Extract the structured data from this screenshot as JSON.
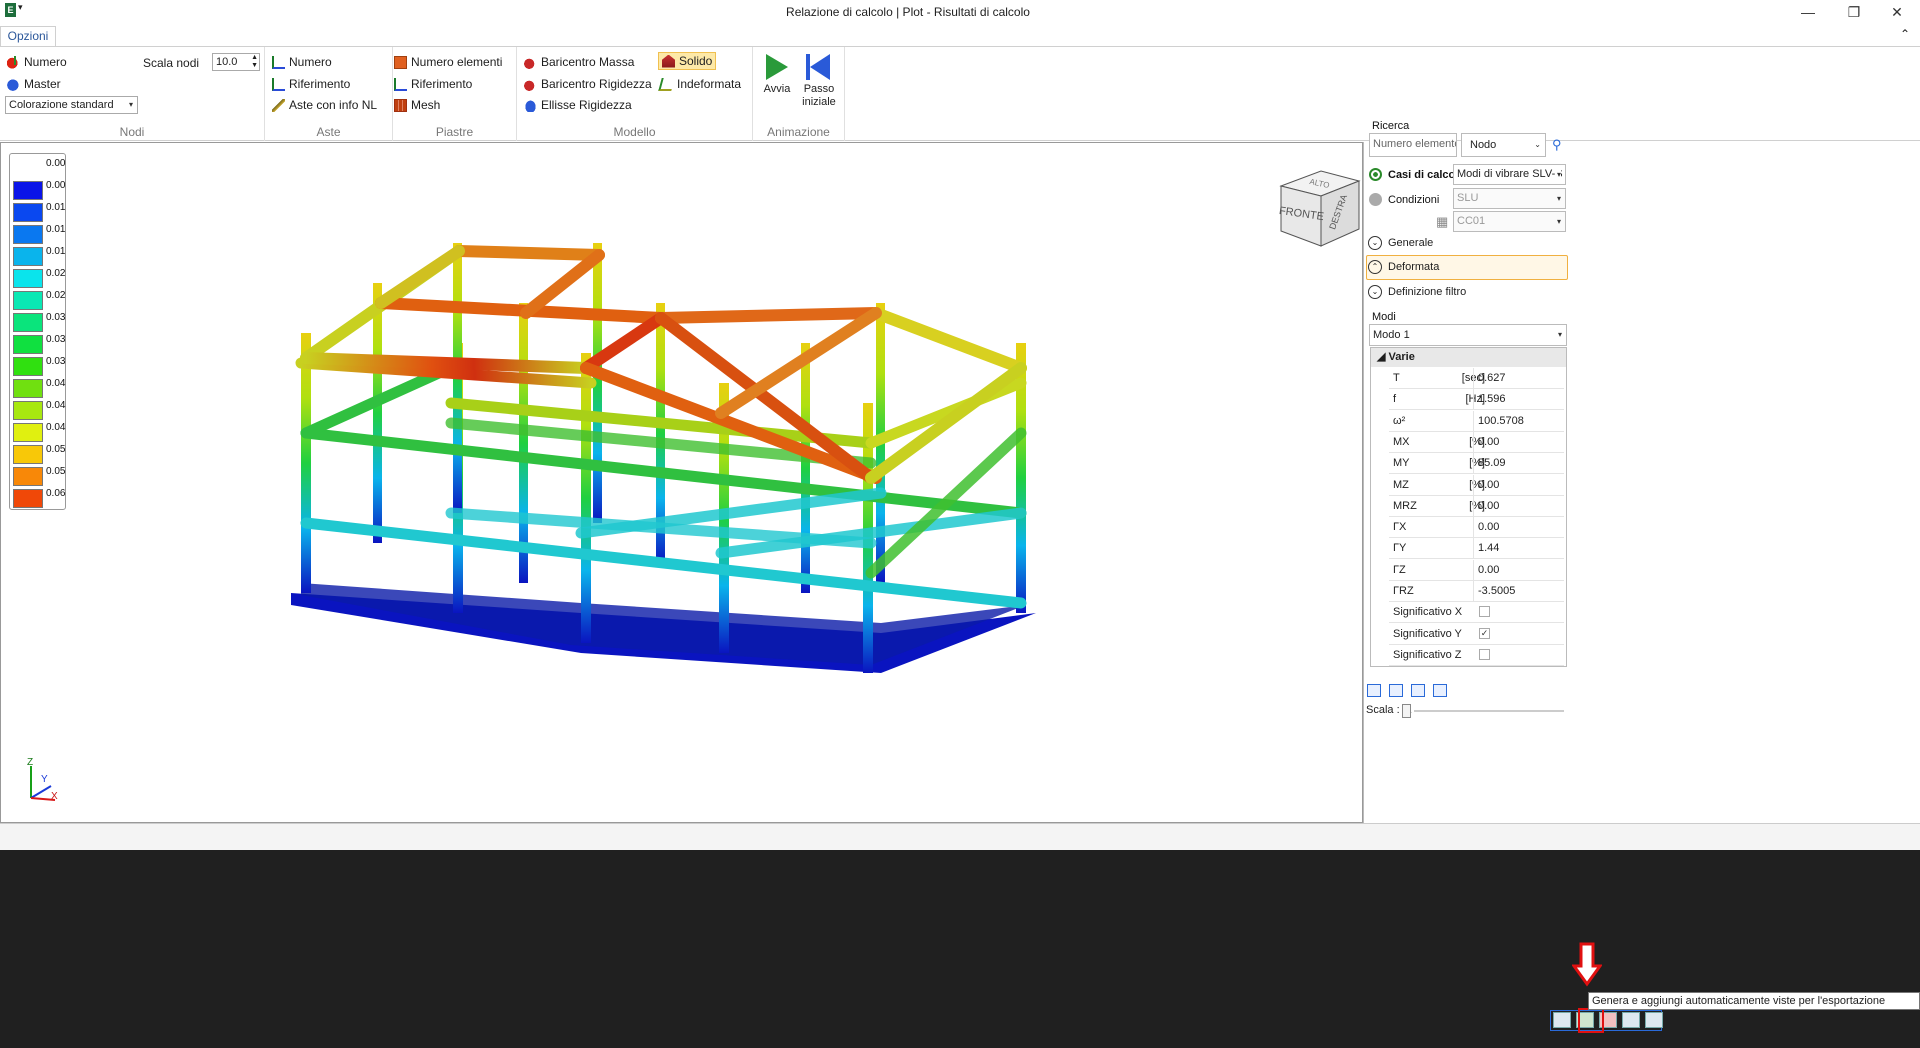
{
  "window": {
    "title": "Relazione di calcolo | Plot - Risultati di calcolo",
    "minimize": "—",
    "maximize": "❐",
    "close": "✕"
  },
  "ribbon": {
    "tab": "Opzioni",
    "nodi": {
      "label": "Nodi",
      "numero": "Numero",
      "master": "Master",
      "coloring": "Colorazione standard",
      "scala_label": "Scala nodi",
      "scala_value": "10.0"
    },
    "aste": {
      "label": "Aste",
      "numero": "Numero",
      "riferimento": "Riferimento",
      "info_nl": "Aste con info NL"
    },
    "piastre": {
      "label": "Piastre",
      "numero_elementi": "Numero elementi",
      "riferimento": "Riferimento",
      "mesh": "Mesh"
    },
    "modello": {
      "label": "Modello",
      "baricentro_massa": "Baricentro Massa",
      "baricentro_rigidezza": "Baricentro Rigidezza",
      "ellisse_rigidezza": "Ellisse Rigidezza",
      "solido": "Solido",
      "indeformata": "Indeformata"
    },
    "animazione": {
      "label": "Animazione",
      "avvia": "Avvia",
      "passo_1": "Passo",
      "passo_2": "iniziale"
    }
  },
  "legend": {
    "values": [
      "0.00",
      "0.00",
      "0.01",
      "0.01",
      "0.01",
      "0.02",
      "0.02",
      "0.03",
      "0.03",
      "0.03",
      "0.04",
      "0.04",
      "0.04",
      "0.05",
      "0.05",
      "0.06"
    ],
    "colors": [
      "#ffffff",
      "#0a14e8",
      "#0a48f0",
      "#0a78f0",
      "#0ab4ec",
      "#0ae4ec",
      "#0ae8b4",
      "#0ae47c",
      "#10e040",
      "#30e010",
      "#70e010",
      "#a8e810",
      "#e0f010",
      "#f8c808",
      "#f88808",
      "#f04808"
    ]
  },
  "viewcube": {
    "top": "ALTO",
    "front": "FRONTE",
    "right": "DESTRA"
  },
  "axes": {
    "x": "X",
    "y": "Y",
    "z": "Z"
  },
  "panel": {
    "ricerca_label": "Ricerca",
    "search_placeholder": "Numero elemento",
    "search_type": "Nodo",
    "casi_label": "Casi di calcolo",
    "casi_value": "Modi di vibrare SLV-S",
    "condizioni_label": "Condizioni",
    "condizioni_value": "SLU",
    "cc_value": "CC01",
    "generale": "Generale",
    "deformata": "Deformata",
    "filtro": "Definizione filtro",
    "modi_label": "Modi",
    "modi_value": "Modo 1",
    "grid_header": "Varie",
    "rows": [
      {
        "name": "T",
        "unit": "[sec]",
        "value": "0.627"
      },
      {
        "name": "f",
        "unit": "[Hz]",
        "value": "1.596"
      },
      {
        "name": "ω²",
        "unit": "",
        "value": "100.5708"
      },
      {
        "name": "MX",
        "unit": "[%]",
        "value": "0.00"
      },
      {
        "name": "MY",
        "unit": "[%]",
        "value": "85.09"
      },
      {
        "name": "MZ",
        "unit": "[%]",
        "value": "0.00"
      },
      {
        "name": "MRZ",
        "unit": "[%]",
        "value": "0.00"
      },
      {
        "name": "ΓX",
        "unit": "",
        "value": "0.00"
      },
      {
        "name": "ΓY",
        "unit": "",
        "value": "1.44"
      },
      {
        "name": "ΓZ",
        "unit": "",
        "value": "0.00"
      },
      {
        "name": "ΓRZ",
        "unit": "",
        "value": "-3.5005"
      }
    ],
    "checks": [
      {
        "name": "Significativo X",
        "checked": false
      },
      {
        "name": "Significativo Y",
        "checked": true
      },
      {
        "name": "Significativo Z",
        "checked": false
      }
    ],
    "scala_label": "Scala :",
    "scala_value": "1"
  },
  "tooltip": "Genera e aggiungi automaticamente viste per l'esportazione"
}
